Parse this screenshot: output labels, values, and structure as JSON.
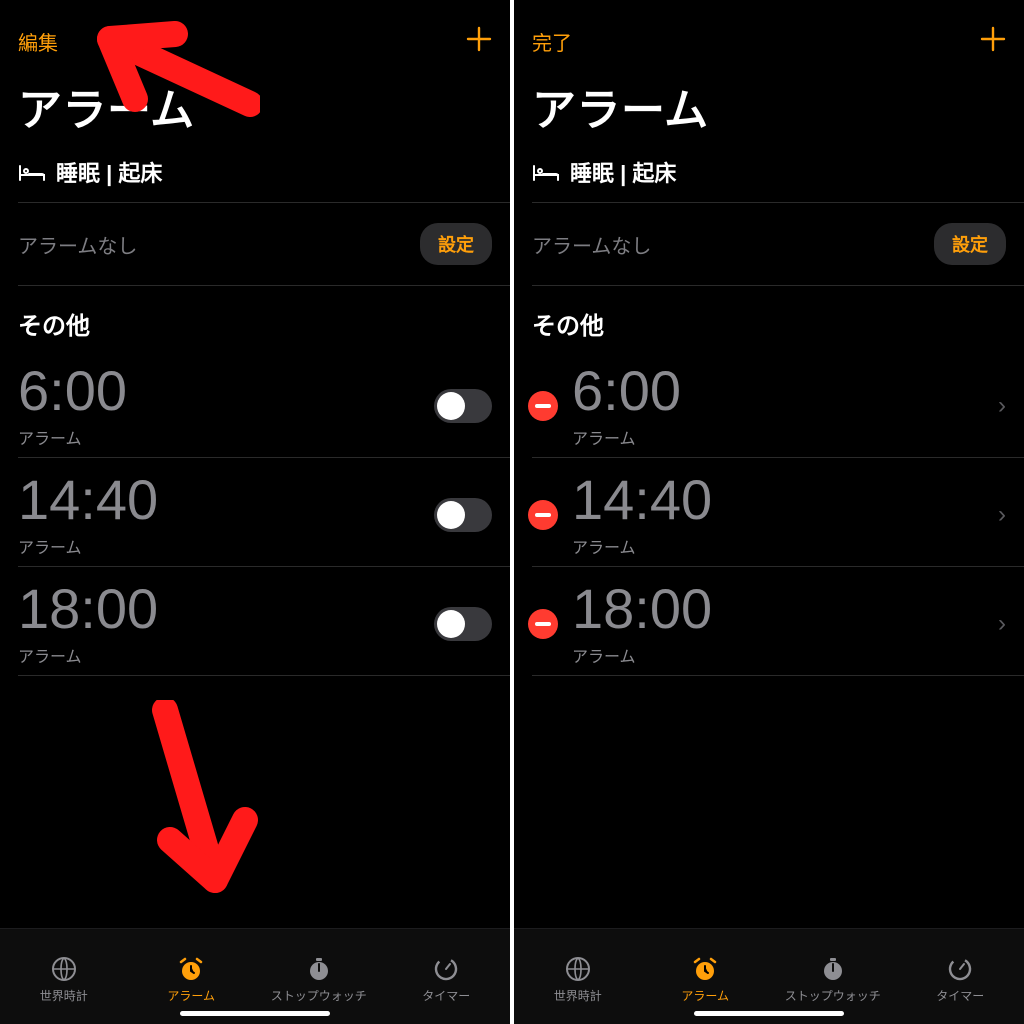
{
  "colors": {
    "accent": "#ff9f0a",
    "danger": "#ff3b30",
    "muted": "#8a8a8f"
  },
  "left": {
    "edit_label": "編集",
    "title": "アラーム",
    "sleep_section": "睡眠 | 起床",
    "no_alarm": "アラームなし",
    "settings_btn": "設定",
    "other_heading": "その他",
    "alarms": [
      {
        "time": "6:00",
        "label": "アラーム",
        "on": false
      },
      {
        "time": "14:40",
        "label": "アラーム",
        "on": false
      },
      {
        "time": "18:00",
        "label": "アラーム",
        "on": false
      }
    ]
  },
  "right": {
    "done_label": "完了",
    "title": "アラーム",
    "sleep_section": "睡眠 | 起床",
    "no_alarm": "アラームなし",
    "settings_btn": "設定",
    "other_heading": "その他",
    "alarms": [
      {
        "time": "6:00",
        "label": "アラーム"
      },
      {
        "time": "14:40",
        "label": "アラーム"
      },
      {
        "time": "18:00",
        "label": "アラーム"
      }
    ]
  },
  "tabs": [
    {
      "id": "world",
      "label": "世界時計"
    },
    {
      "id": "alarm",
      "label": "アラーム"
    },
    {
      "id": "stopwatch",
      "label": "ストップウォッチ"
    },
    {
      "id": "timer",
      "label": "タイマー"
    }
  ],
  "active_tab": "alarm",
  "annotation": {
    "arrow_top_target": "edit-button",
    "arrow_bottom_target": "tab-alarm"
  }
}
